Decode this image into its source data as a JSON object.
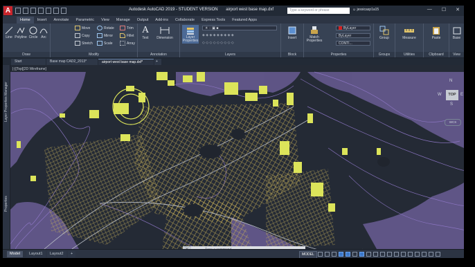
{
  "app": {
    "logo": "A",
    "title": "Autodesk AutoCAD 2019 - STUDENT VERSION",
    "file_name": "airport west base map.dxf",
    "search_placeholder": "Type a keyword or phrase",
    "user": "jessicasp1a15",
    "window_buttons": [
      "—",
      "☐",
      "✕"
    ]
  },
  "ribbon_tabs": [
    "Home",
    "Insert",
    "Annotate",
    "Parametric",
    "View",
    "Manage",
    "Output",
    "Add-ins",
    "Collaborate",
    "Express Tools",
    "Featured Apps"
  ],
  "ribbon_active_tab": "Home",
  "panels": {
    "draw": {
      "title": "Draw",
      "tools": [
        "Line",
        "Polyline",
        "Circle",
        "Arc"
      ]
    },
    "modify": {
      "title": "Modify",
      "tools": [
        "Move",
        "Rotate",
        "Trim",
        "Copy",
        "Mirror",
        "Fillet",
        "Stretch",
        "Scale",
        "Array"
      ]
    },
    "annotation": {
      "title": "Annotation",
      "tools": [
        "Text",
        "Dimension"
      ]
    },
    "layers": {
      "title": "Layers",
      "tool": "Layer Properties"
    },
    "block": {
      "title": "Block",
      "tool": "Insert"
    },
    "properties": {
      "title": "Properties",
      "tool": "Match Properties",
      "color": "ByLayer",
      "lineweight": "ByLayer",
      "linetype": "CONTI..."
    },
    "groups": {
      "title": "Groups",
      "tool": "Group"
    },
    "utilities": {
      "title": "Utilities",
      "tool": "Measure"
    },
    "clipboard": {
      "title": "Clipboard",
      "tool": "Paste"
    },
    "view": {
      "title": "View",
      "tool": "Base"
    }
  },
  "doc_tabs": [
    "Start",
    "Base map CAD2_2013*",
    "airport west base map.dxf*"
  ],
  "viewport_label": "[-][Top][2D Wireframe]",
  "side_labels": [
    "Layer Properties Manager",
    "Properties"
  ],
  "viewcube": {
    "top": "TOP",
    "n": "N",
    "w": "W",
    "e": "E",
    "s": "S",
    "wcs": "WCS"
  },
  "command_line_placeholder": "Type a command",
  "layout_tabs": [
    "Model",
    "Layout1",
    "Layout2"
  ],
  "model_button": "MODEL",
  "colors": {
    "buildings": "#dce45a",
    "contours": "#8f78c8",
    "streets": "#d6bb57",
    "canvas": "#242a35"
  }
}
